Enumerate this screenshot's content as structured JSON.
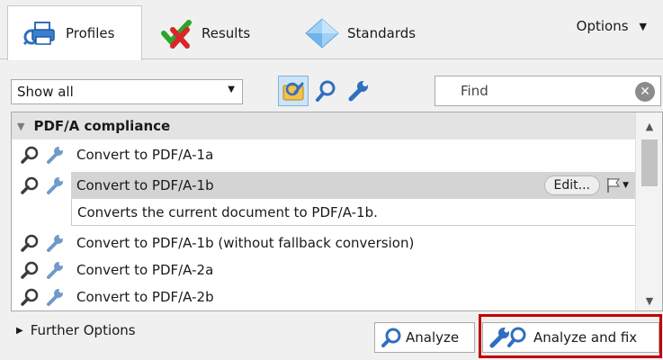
{
  "tabs": [
    {
      "label": "Profiles",
      "icon": "profiles-printer-icon",
      "active": true
    },
    {
      "label": "Results",
      "icon": "results-check-cross-icon",
      "active": false
    },
    {
      "label": "Standards",
      "icon": "standards-diamond-icon",
      "active": false
    }
  ],
  "options": {
    "label": "Options"
  },
  "toolbar": {
    "filter_value": "Show all",
    "find_placeholder": "Find"
  },
  "list": {
    "group": "PDF/A compliance",
    "items": [
      {
        "label": "Convert to PDF/A-1a"
      },
      {
        "label": "Convert to PDF/A-1b"
      },
      {
        "label": "Convert to PDF/A-1b (without fallback conversion)"
      },
      {
        "label": "Convert to PDF/A-2a"
      },
      {
        "label": "Convert to PDF/A-2b"
      }
    ],
    "selected_description": "Converts the current document to PDF/A-1b.",
    "edit_label": "Edit..."
  },
  "bottom": {
    "further_options": "Further Options",
    "analyze": "Analyze",
    "analyze_fix": "Analyze and fix"
  },
  "colors": {
    "highlight": "#c00000",
    "selected_row": "#d4d4d4",
    "accent_blue": "#2f6fc1"
  }
}
